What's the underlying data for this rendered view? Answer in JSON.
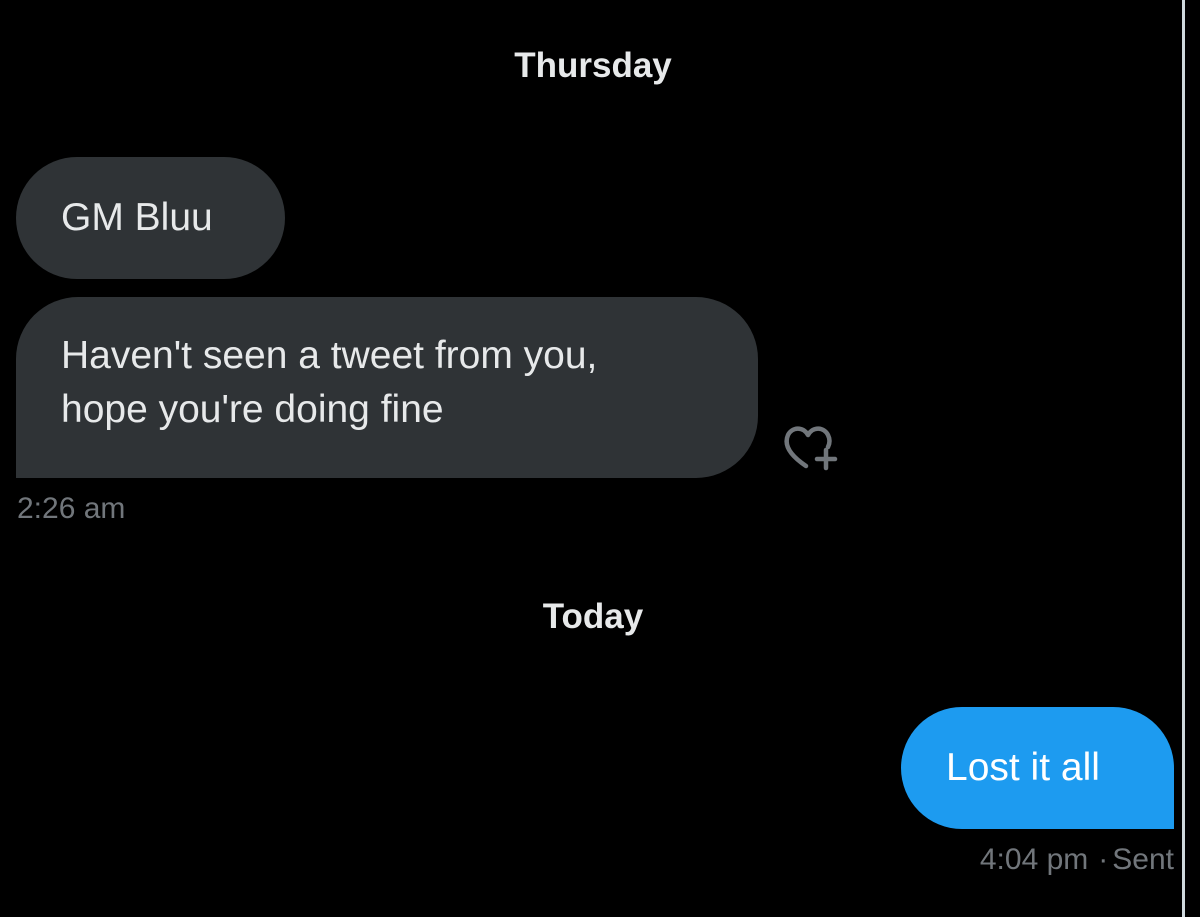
{
  "conversation": {
    "separators": {
      "thursday": "Thursday",
      "today": "Today"
    },
    "messages": [
      {
        "direction": "received",
        "lines": [
          "GM Bluu"
        ]
      },
      {
        "direction": "received",
        "lines": [
          "Haven't seen a tweet from you,",
          "hope you're doing fine"
        ],
        "timestamp": "2:26 am"
      },
      {
        "direction": "sent",
        "lines": [
          "Lost it all"
        ],
        "timestamp": "4:04 pm",
        "status_separator": "·",
        "status": "Sent"
      }
    ]
  },
  "icons": {
    "reaction": "heart-plus-icon"
  },
  "colors": {
    "background": "#000000",
    "received_bubble": "#2f3336",
    "sent_bubble": "#1d9bf0",
    "primary_text": "#e7e9ea",
    "secondary_text": "#71767b"
  }
}
